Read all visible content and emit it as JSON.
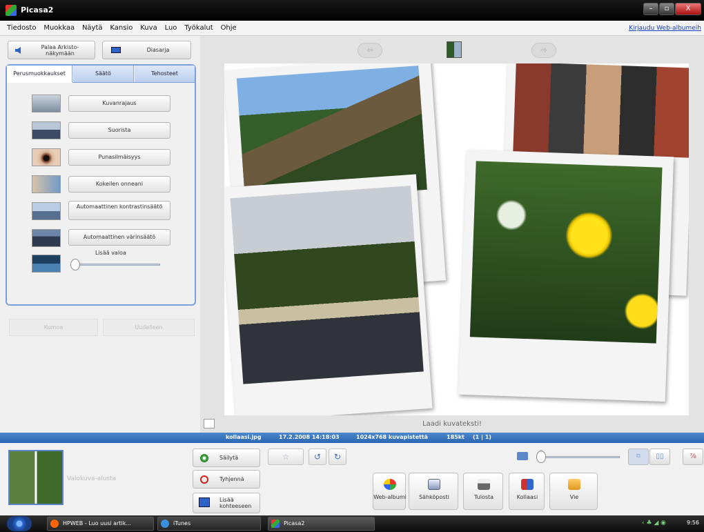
{
  "window": {
    "title": "Picasa2",
    "min": "–",
    "max": "▫",
    "close": "X"
  },
  "menu": {
    "items": [
      "Tiedosto",
      "Muokkaa",
      "Näytä",
      "Kansio",
      "Kuva",
      "Luo",
      "Työkalut",
      "Ohje"
    ],
    "web_link": "Kirjaudu Web-albumeih"
  },
  "left": {
    "back_label": "Palaa Arkisto-näkymään",
    "slideshow_label": "Diasarja",
    "tabs": [
      "Perusmuokkaukset",
      "Säätö",
      "Tehosteet"
    ],
    "tools": [
      "Kuvanrajaus",
      "Suorista",
      "Punasilmäisyys",
      "Kokeilen onneani",
      "Automaattinen kontrastinsäätö",
      "Automaattinen värinsäätö"
    ],
    "fill_light_label": "Lisää valoa",
    "fill_light_value": 0,
    "undo_label": "Kumoa",
    "redo_label": "Uudelleen"
  },
  "main": {
    "prev": "⇦",
    "next": "⇨",
    "caption_placeholder": "Laadi kuvateksti!"
  },
  "status": {
    "filename": "kollaasi.jpg",
    "datetime": "17.2.2008 14:18:03",
    "dimensions": "1024x768 kuvapistettä",
    "size": "185kt",
    "index": "(1 | 1)"
  },
  "tray": {
    "label": "Valokuva-alusta",
    "hold_label": "Säilytä",
    "clear_label": "Tyhjennä",
    "add_album_label": "Lisää kohteeseen",
    "star": "☆",
    "rotate_left": "↺",
    "rotate_right": "↻",
    "actions": [
      "Web-albumi",
      "Sähköposti",
      "Tulosta",
      "Kollaasi",
      "Vie"
    ],
    "views": [
      "⌑",
      "▯▯",
      "⅞"
    ]
  },
  "taskbar": {
    "tasks": [
      "HPWEB - Luo uusi artik...",
      "iTunes",
      "Picasa2"
    ],
    "clock": "9:56",
    "tray_icons": "‹ ♣ ◢ ◉"
  }
}
